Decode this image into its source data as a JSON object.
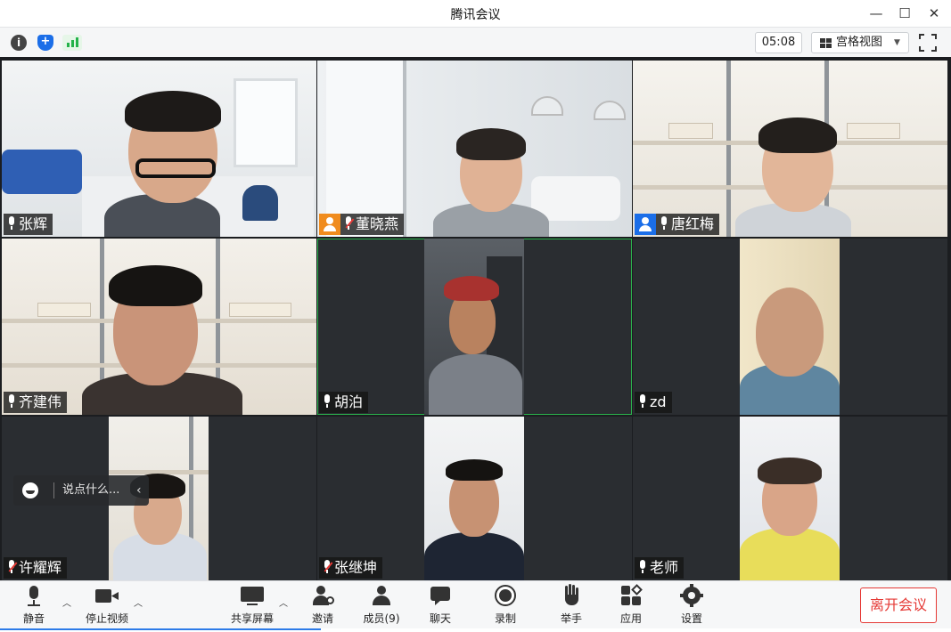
{
  "window": {
    "title": "腾讯会议"
  },
  "infobar": {
    "timer": "05:08",
    "view_mode": "宫格视图"
  },
  "participants": [
    {
      "name": "张辉"
    },
    {
      "name": "董晓燕"
    },
    {
      "name": "唐红梅"
    },
    {
      "name": "齐建伟"
    },
    {
      "name": "胡泊"
    },
    {
      "name": "zd"
    },
    {
      "name": "许耀辉"
    },
    {
      "name": "张继坤"
    },
    {
      "name": "老师"
    }
  ],
  "chat": {
    "placeholder": "说点什么..."
  },
  "toolbar": {
    "mute_label": "静音",
    "stop_video_label": "停止视频",
    "share_label": "共享屏幕",
    "invite_label": "邀请",
    "members_label": "成员(9)",
    "chat_label": "聊天",
    "record_label": "录制",
    "raise_hand_label": "举手",
    "apps_label": "应用",
    "settings_label": "设置",
    "leave_label": "离开会议"
  },
  "colors": {
    "accent": "#2d7be8",
    "leave": "#e53935",
    "active_speaker": "#2bb24c"
  }
}
